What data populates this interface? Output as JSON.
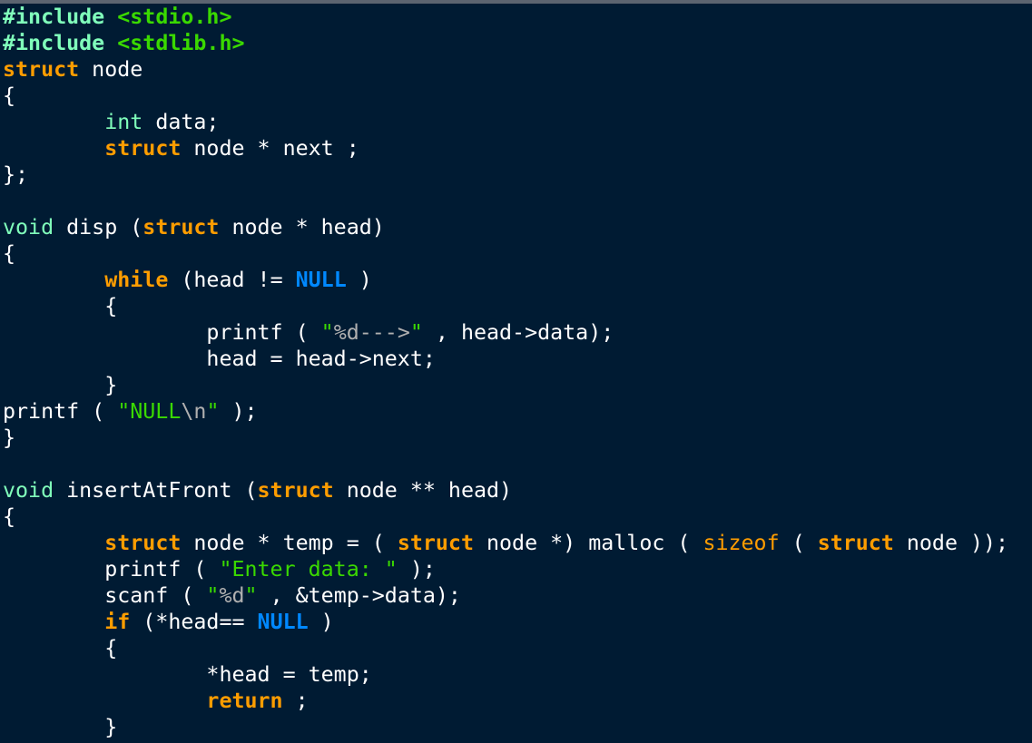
{
  "editor": {
    "lines": [
      [
        {
          "t": "#include",
          "k": "include"
        },
        {
          "t": " ",
          "k": "plain"
        },
        {
          "t": "<stdio.h>",
          "k": "header"
        }
      ],
      [
        {
          "t": "#include",
          "k": "include"
        },
        {
          "t": " ",
          "k": "plain"
        },
        {
          "t": "<stdlib.h>",
          "k": "header"
        }
      ],
      [
        {
          "t": "struct",
          "k": "keyword"
        },
        {
          "t": " node",
          "k": "plain"
        }
      ],
      [
        {
          "t": "{",
          "k": "plain"
        }
      ],
      [
        {
          "t": "        ",
          "k": "plain"
        },
        {
          "t": "int",
          "k": "type"
        },
        {
          "t": " data;",
          "k": "plain"
        }
      ],
      [
        {
          "t": "        ",
          "k": "plain"
        },
        {
          "t": "struct",
          "k": "keyword"
        },
        {
          "t": " node * next ;",
          "k": "plain"
        }
      ],
      [
        {
          "t": "};",
          "k": "plain"
        }
      ],
      [],
      [
        {
          "t": "void",
          "k": "voidkw"
        },
        {
          "t": " disp (",
          "k": "plain"
        },
        {
          "t": "struct",
          "k": "keyword"
        },
        {
          "t": " node * head)",
          "k": "plain"
        }
      ],
      [
        {
          "t": "{",
          "k": "plain"
        }
      ],
      [
        {
          "t": "        ",
          "k": "plain"
        },
        {
          "t": "while",
          "k": "keyword"
        },
        {
          "t": " (head != ",
          "k": "plain"
        },
        {
          "t": "NULL",
          "k": "const"
        },
        {
          "t": " )",
          "k": "plain"
        }
      ],
      [
        {
          "t": "        {",
          "k": "plain"
        }
      ],
      [
        {
          "t": "                printf ( ",
          "k": "plain"
        },
        {
          "t": "\"",
          "k": "string"
        },
        {
          "t": "%d--->",
          "k": "escape"
        },
        {
          "t": "\"",
          "k": "string"
        },
        {
          "t": " , head->data);",
          "k": "plain"
        }
      ],
      [
        {
          "t": "                head = head->next;",
          "k": "plain"
        }
      ],
      [
        {
          "t": "        }",
          "k": "plain"
        }
      ],
      [
        {
          "t": "printf ( ",
          "k": "plain"
        },
        {
          "t": "\"NULL",
          "k": "string"
        },
        {
          "t": "\\n",
          "k": "escape"
        },
        {
          "t": "\"",
          "k": "string"
        },
        {
          "t": " );",
          "k": "plain"
        }
      ],
      [
        {
          "t": "}",
          "k": "plain"
        }
      ],
      [],
      [
        {
          "t": "void",
          "k": "voidkw"
        },
        {
          "t": " insertAtFront (",
          "k": "plain"
        },
        {
          "t": "struct",
          "k": "keyword"
        },
        {
          "t": " node ** head)",
          "k": "plain"
        }
      ],
      [
        {
          "t": "{",
          "k": "plain"
        }
      ],
      [
        {
          "t": "        ",
          "k": "plain"
        },
        {
          "t": "struct",
          "k": "keyword"
        },
        {
          "t": " node * temp = ( ",
          "k": "plain"
        },
        {
          "t": "struct",
          "k": "keyword"
        },
        {
          "t": " node *) malloc ( ",
          "k": "plain"
        },
        {
          "t": "sizeof",
          "k": "kwfunc"
        },
        {
          "t": " ( ",
          "k": "plain"
        },
        {
          "t": "struct",
          "k": "keyword"
        },
        {
          "t": " node ));",
          "k": "plain"
        }
      ],
      [
        {
          "t": "        printf ( ",
          "k": "plain"
        },
        {
          "t": "\"Enter data: \"",
          "k": "string"
        },
        {
          "t": " );",
          "k": "plain"
        }
      ],
      [
        {
          "t": "        scanf ( ",
          "k": "plain"
        },
        {
          "t": "\"",
          "k": "string"
        },
        {
          "t": "%d",
          "k": "escape"
        },
        {
          "t": "\"",
          "k": "string"
        },
        {
          "t": " , &temp->data);",
          "k": "plain"
        }
      ],
      [
        {
          "t": "        ",
          "k": "plain"
        },
        {
          "t": "if",
          "k": "keyword"
        },
        {
          "t": " (*head== ",
          "k": "plain"
        },
        {
          "t": "NULL",
          "k": "const"
        },
        {
          "t": " )",
          "k": "plain"
        }
      ],
      [
        {
          "t": "        {",
          "k": "plain"
        }
      ],
      [
        {
          "t": "                *head = temp;",
          "k": "plain"
        }
      ],
      [
        {
          "t": "                ",
          "k": "plain"
        },
        {
          "t": "return",
          "k": "keyword"
        },
        {
          "t": " ;",
          "k": "plain"
        }
      ],
      [
        {
          "t": "        }",
          "k": "plain"
        }
      ]
    ]
  }
}
